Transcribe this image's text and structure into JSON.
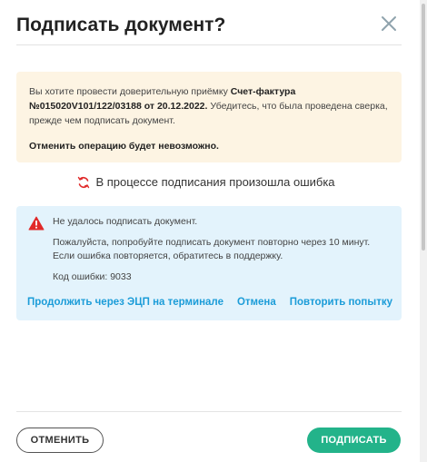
{
  "dialog": {
    "title": "Подписать документ?",
    "close_icon": "close-icon"
  },
  "warning": {
    "text_before": "Вы хотите провести доверительную приёмку ",
    "doc_name": "Счет-фактура №015020V101/122/03188 от 20.12.2022.",
    "text_after": " Убедитесь, что была проведена сверка, прежде чем подписать документ.",
    "irreversible": "Отменить операцию будет невозможно."
  },
  "status": {
    "icon": "sync-error-icon",
    "text": "В процессе подписания произошла ошибка"
  },
  "error": {
    "icon": "alert-triangle-icon",
    "line1": "Не удалось подписать документ.",
    "line2": "Пожалуйста, попробуйте подписать документ повторно через 10 минут. Если ошибка повторяется, обратитесь в поддержку.",
    "code": "Код ошибки: 9033",
    "links": {
      "terminal": "Продолжить через ЭЦП на терминале",
      "cancel": "Отмена",
      "retry": "Повторить попытку"
    }
  },
  "footer": {
    "cancel_label": "ОТМЕНИТЬ",
    "sign_label": "ПОДПИСАТЬ"
  },
  "colors": {
    "accent_green": "#23b38a",
    "link_blue": "#1b9cd8",
    "warning_bg": "#fdf4e3",
    "error_bg": "#e3f3fc",
    "error_red": "#e02a2a"
  }
}
